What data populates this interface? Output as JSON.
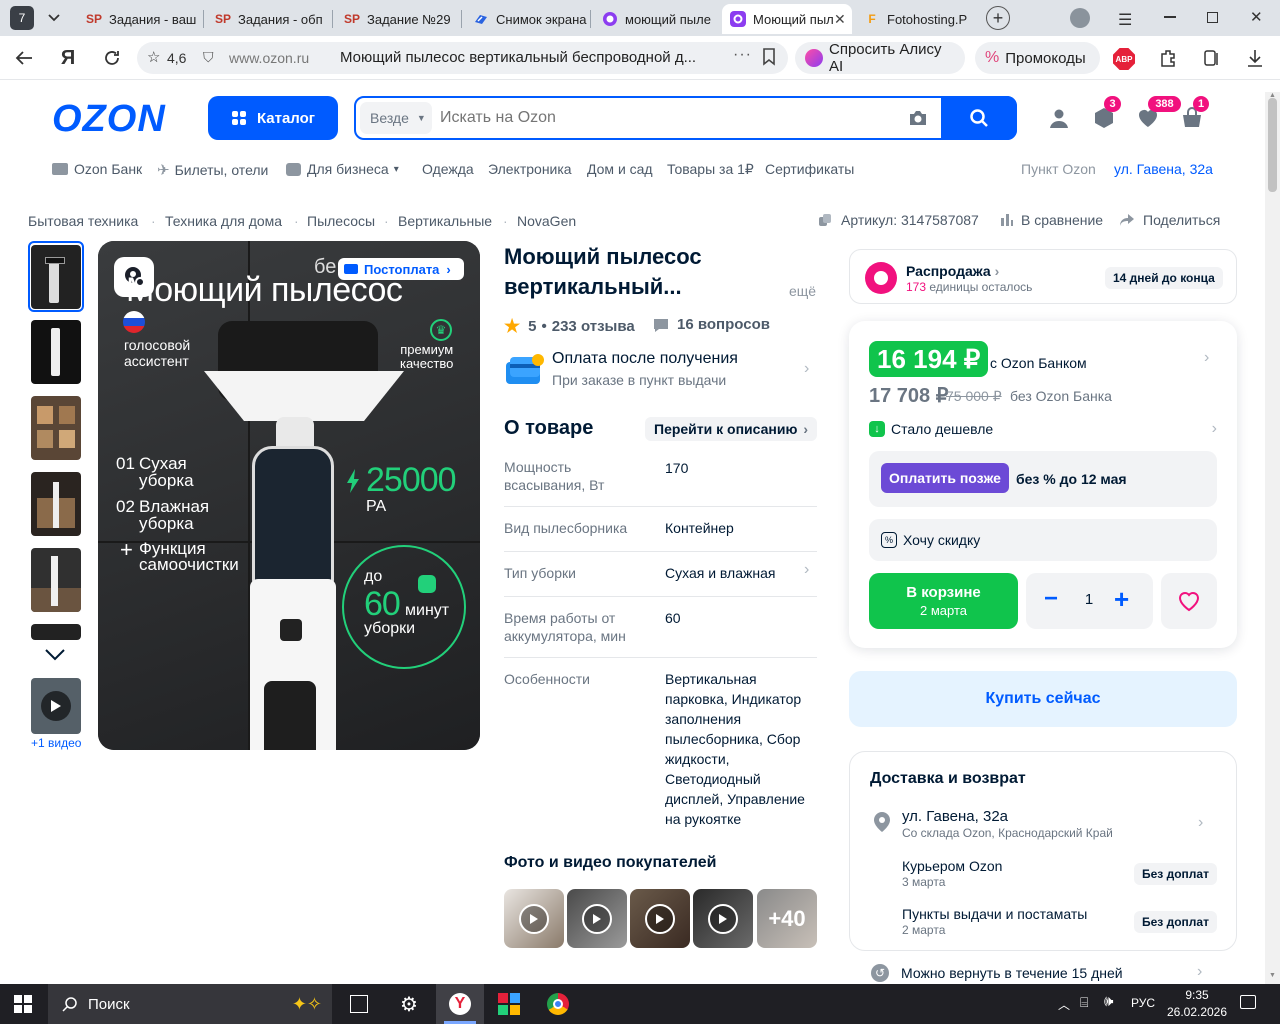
{
  "browser": {
    "tab_counter": "7",
    "tabs": [
      {
        "title": "Задания - ваш",
        "fav": "SP",
        "active": false
      },
      {
        "title": "Задания - обп",
        "fav": "SP",
        "active": false
      },
      {
        "title": "Задание №29",
        "fav": "SP",
        "active": false
      },
      {
        "title": "Снимок экрана",
        "fav": "",
        "active": false
      },
      {
        "title": "моющий пыле",
        "fav": "",
        "active": false
      },
      {
        "title": "Моющий пыл",
        "fav": "",
        "active": true
      },
      {
        "title": "Fotohosting.P",
        "fav": "F",
        "active": false
      }
    ],
    "rating": "4,6",
    "domain": "www.ozon.ru",
    "page_title": "Моющий пылесос вертикальный беспроводной д...",
    "alice": "Спросить Алису AI",
    "promo": "Промокоды",
    "adblock": "ABP"
  },
  "header": {
    "logo": "OZON",
    "catalog": "Каталог",
    "search_scope": "Везде",
    "search_placeholder": "Искать на Ozon",
    "badges": {
      "orders": "3",
      "favorites": "388",
      "cart": "1"
    }
  },
  "menu": {
    "items": [
      "Ozon Банк",
      "Билеты, отели",
      "Для бизнеса",
      "Одежда",
      "Электроника",
      "Дом и сад",
      "Товары за 1₽",
      "Сертификаты"
    ],
    "pickup_label": "Пункт Ozon",
    "pickup_address": "ул. Гавена, 32а"
  },
  "breadcrumbs": [
    "Бытовая техника",
    "Техника для дома",
    "Пылесосы",
    "Вертикальные",
    "NovaGen"
  ],
  "article": "Артикул: 3147587087",
  "compare": "В сравнение",
  "share": "Поделиться",
  "gallery": {
    "video_label": "+1 видео",
    "image_texts": {
      "postpay": "Постоплата",
      "headline_partial": "бе",
      "headline": "Моющий пылесос",
      "voice": "голосовой\nассистент",
      "premium": "премиум\nкачество",
      "dry_num": "01",
      "dry": "Сухая\nуборка",
      "wet_num": "02",
      "wet": "Влажная\nуборка",
      "self_plus": "+",
      "self": "Функция\nсамоочистки",
      "power": "25000",
      "power_unit": "PA",
      "up_to": "до",
      "minutes": "60",
      "minutes_unit": "минут",
      "cleaning": "уборки"
    }
  },
  "product": {
    "title": "Моющий пылесос вертикальный...",
    "more": "ещё",
    "rating": "5",
    "reviews": "233 отзыва",
    "questions": "16 вопросов",
    "payment_title": "Оплата после получения",
    "payment_sub": "При заказе в пункт выдачи",
    "about": "О товаре",
    "to_description": "Перейти к описанию",
    "specs": [
      {
        "k": "Мощность всасывания, Вт",
        "v": "170"
      },
      {
        "k": "Вид пылесборника",
        "v": "Контейнер"
      },
      {
        "k": "Тип уборки",
        "v": "Сухая и влажная"
      },
      {
        "k": "Время работы от аккумулятора, мин",
        "v": "60"
      },
      {
        "k": "Особенности",
        "v": "Вертикальная парковка, Индикатор заполнения пылесборника, Сбор жидкости, Светодиодный дисплей, Управление на рукоятке"
      }
    ],
    "buyer_media_title": "Фото и видео покупателей",
    "buyer_media_more": "+40"
  },
  "sale": {
    "title": "Распродажа",
    "count": "173",
    "left": "единицы осталось",
    "days": "14 дней до конца"
  },
  "price": {
    "bank_price": "16 194 ₽",
    "bank_label": "с Ozon Банком",
    "price": "17 708 ₽",
    "old_price": "75 000 ₽",
    "no_bank_label": "без Ozon Банка",
    "cheaper": "Стало дешевле",
    "pay_later_btn": "Оплатить позже",
    "pay_later_text": "без % до 12 мая",
    "want_discount": "Хочу скидку",
    "in_cart": "В корзине",
    "cart_date": "2 марта",
    "qty": "1",
    "buy_now": "Купить сейчас"
  },
  "delivery": {
    "title": "Доставка и возврат",
    "address": "ул. Гавена, 32а",
    "warehouse": "Со склада Ozon, Краснодарский Край",
    "courier": "Курьером Ozon",
    "courier_date": "3 марта",
    "courier_tag": "Без доплат",
    "points": "Пункты выдачи и постаматы",
    "points_date": "2 марта",
    "points_tag": "Без доплат",
    "returns": "Можно вернуть в течение 15 дней"
  },
  "taskbar": {
    "search": "Поиск",
    "lang": "РУС",
    "time": "9:35",
    "date": "26.02.2026"
  },
  "colors": {
    "ozon_blue": "#005bff",
    "green": "#10c44c",
    "pink": "#f1117e",
    "purple": "#6c4ad6"
  }
}
